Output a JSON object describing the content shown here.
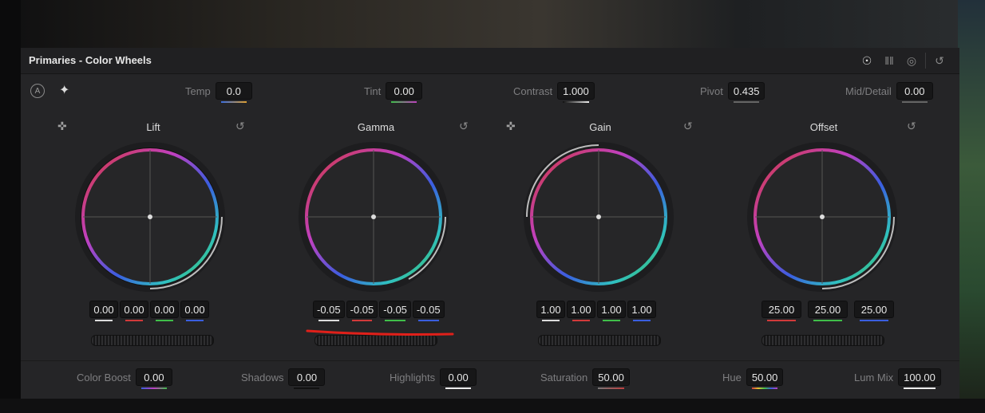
{
  "panel": {
    "title": "Primaries - Color Wheels"
  },
  "mode_icons": [
    "color-wheels-icon",
    "bars-icon",
    "log-wheels-icon",
    "reset-all-icon"
  ],
  "top_params": [
    {
      "label": "Temp",
      "value": "0.0"
    },
    {
      "label": "Tint",
      "value": "0.00"
    },
    {
      "label": "Contrast",
      "value": "1.000"
    },
    {
      "label": "Pivot",
      "value": "0.435"
    },
    {
      "label": "Mid/Detail",
      "value": "0.00"
    }
  ],
  "auto_button": "A",
  "wheels": [
    {
      "name": "Lift",
      "values": [
        "0.00",
        "0.00",
        "0.00",
        "0.00"
      ]
    },
    {
      "name": "Gamma",
      "values": [
        "-0.05",
        "-0.05",
        "-0.05",
        "-0.05"
      ]
    },
    {
      "name": "Gain",
      "values": [
        "1.00",
        "1.00",
        "1.00",
        "1.00"
      ]
    },
    {
      "name": "Offset",
      "values": [
        "25.00",
        "25.00",
        "25.00"
      ]
    }
  ],
  "bottom_params": [
    {
      "label": "Color Boost",
      "value": "0.00"
    },
    {
      "label": "Shadows",
      "value": "0.00"
    },
    {
      "label": "Highlights",
      "value": "0.00"
    },
    {
      "label": "Saturation",
      "value": "50.00"
    },
    {
      "label": "Hue",
      "value": "50.00"
    },
    {
      "label": "Lum Mix",
      "value": "100.00"
    }
  ],
  "colors": {
    "accent": "#e0e0e0",
    "red": "#d23a3a",
    "green": "#3fbf4a",
    "blue": "#3a5ee0",
    "annotation": "#e0201a"
  }
}
